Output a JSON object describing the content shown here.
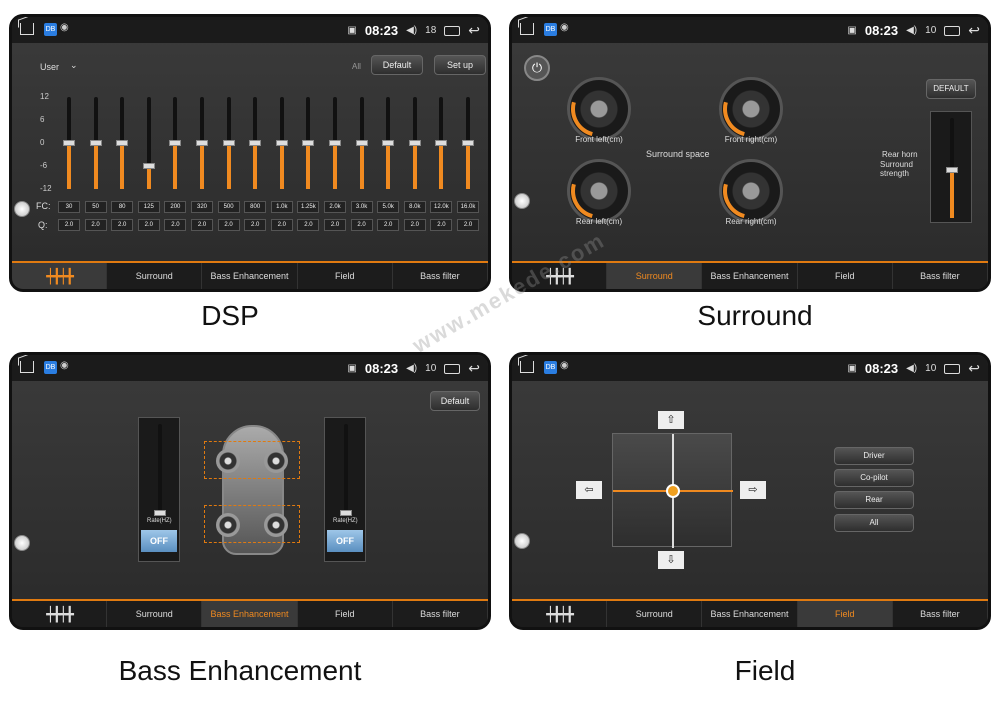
{
  "status": {
    "time": "08:23"
  },
  "panels": {
    "dsp": {
      "caption": "DSP",
      "volume": "18",
      "mode": "User",
      "all_label": "All",
      "default_btn": "Default",
      "setup_btn": "Set up",
      "yticks": [
        "12",
        "6",
        "0",
        "-6",
        "-12"
      ],
      "fc_label": "FC:",
      "q_label": "Q:",
      "fc": [
        "30",
        "50",
        "80",
        "125",
        "200",
        "320",
        "500",
        "800",
        "1.0k",
        "1.25k",
        "2.0k",
        "3.0k",
        "5.0k",
        "8.0k",
        "12.0k",
        "16.0k"
      ],
      "q": [
        "2.0",
        "2.0",
        "2.0",
        "2.0",
        "2.0",
        "2.0",
        "2.0",
        "2.0",
        "2.0",
        "2.0",
        "2.0",
        "2.0",
        "2.0",
        "2.0",
        "2.0",
        "2.0"
      ],
      "gains": [
        0,
        0,
        0,
        -6,
        0,
        0,
        0,
        0,
        0,
        0,
        0,
        0,
        0,
        0,
        0,
        0
      ],
      "tabs": [
        "",
        "Surround",
        "Bass Enhancement",
        "Field",
        "Bass filter"
      ],
      "active": 0
    },
    "surround": {
      "caption": "Surround",
      "volume": "10",
      "default_btn": "DEFAULT",
      "center_label": "Surround space",
      "gauges": [
        "Front left(cm)",
        "Front right(cm)",
        "Rear left(cm)",
        "Rear right(cm)"
      ],
      "rear_horn": "Rear horn",
      "strength": "Surround strength",
      "tabs": [
        "",
        "Surround",
        "Bass Enhancement",
        "Field",
        "Bass filter"
      ],
      "active": 1
    },
    "bass": {
      "caption": "Bass Enhancement",
      "volume": "10",
      "default_btn": "Default",
      "rate_label": "Rate(HZ)",
      "off_label": "OFF",
      "tabs": [
        "",
        "Surround",
        "Bass Enhancement",
        "Field",
        "Bass filter"
      ],
      "active": 2
    },
    "field": {
      "caption": "Field",
      "volume": "10",
      "buttons": [
        "Driver",
        "Co-pilot",
        "Rear",
        "All"
      ],
      "tabs": [
        "",
        "Surround",
        "Bass Enhancement",
        "Field",
        "Bass filter"
      ],
      "active": 3
    }
  },
  "watermark": "www.mekede.com",
  "colors": {
    "accent": "#f08a20",
    "panel_bg": "#333333",
    "tabbar_bg": "#1c1c1c"
  }
}
